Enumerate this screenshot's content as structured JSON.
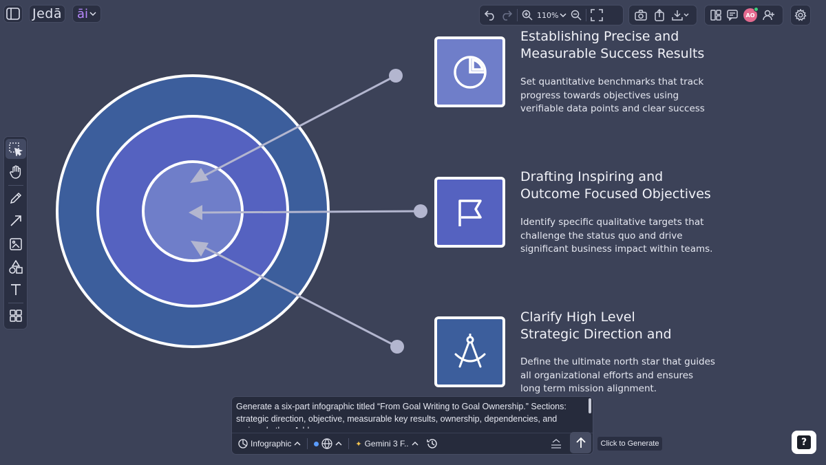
{
  "header": {
    "logo_text": "Jedā",
    "ai_menu_label": "āi",
    "zoom_level": "110%",
    "avatar_initials": "AO"
  },
  "infographic": {
    "items": [
      {
        "title_line1": "Establishing Precise and",
        "title_line2": "Measurable Success Results",
        "text_line1": "Set quantitative benchmarks that track",
        "text_line2": "progress towards objectives using",
        "text_line3": "verifiable data points and clear success",
        "icon": "pie-chart-icon",
        "color": "#6f7ec9"
      },
      {
        "title_line1": "Drafting Inspiring and",
        "title_line2": "Outcome Focused Objectives",
        "text_line1": "Identify specific qualitative targets that",
        "text_line2": "challenge the status quo and drive",
        "text_line3": "significant business impact within teams.",
        "icon": "flag-icon",
        "color": "#5562c0"
      },
      {
        "title_line1": "Clarify High Level",
        "title_line2": "Strategic Direction and",
        "text_line1": "Define the ultimate north star that guides",
        "text_line2": "all organizational efforts and ensures",
        "text_line3": "long term mission alignment.",
        "icon": "compass-icon",
        "color": "#3c5e9c"
      }
    ],
    "ring_colors": {
      "outer": "#3c5e9c",
      "middle": "#5562c0",
      "inner": "#6f7ec9"
    }
  },
  "prompt": {
    "text": "Generate a six-part infographic titled “From Goal Writing to Goal Ownership.” Sections: strategic direction, objective, measurable key results, ownership, dependencies, and review rhythm. Add a",
    "mode_label": "Infographic",
    "model_label": "Gemini 3 F..",
    "tooltip": "Click to Generate"
  }
}
